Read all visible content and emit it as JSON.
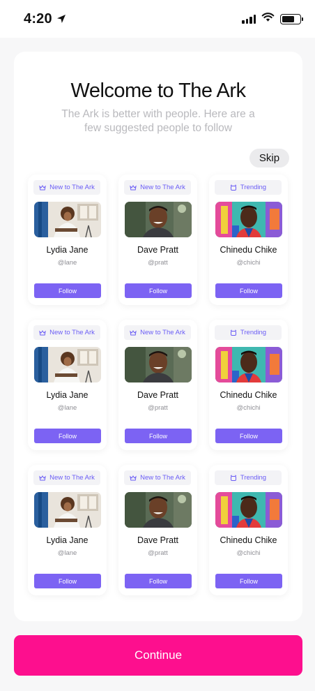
{
  "status_bar": {
    "time": "4:20"
  },
  "header": {
    "title": "Welcome to The Ark",
    "subtitle": "The Ark is better with people. Here are a few suggested people to follow",
    "skip_label": "Skip"
  },
  "cards": [
    {
      "badge": "New to The Ark",
      "badge_icon": "crown-icon",
      "name": "Lydia Jane",
      "handle": "@lane",
      "button": "Follow",
      "photo": "lydia"
    },
    {
      "badge": "New to The Ark",
      "badge_icon": "crown-icon",
      "name": "Dave Pratt",
      "handle": "@pratt",
      "button": "Follow",
      "photo": "dave"
    },
    {
      "badge": "Trending",
      "badge_icon": "alarm-icon",
      "name": "Chinedu Chike",
      "handle": "@chichi",
      "button": "Follow",
      "photo": "chinedu"
    },
    {
      "badge": "New to The Ark",
      "badge_icon": "crown-icon",
      "name": "Lydia Jane",
      "handle": "@lane",
      "button": "Follow",
      "photo": "lydia"
    },
    {
      "badge": "New to The Ark",
      "badge_icon": "crown-icon",
      "name": "Dave Pratt",
      "handle": "@pratt",
      "button": "Follow",
      "photo": "dave"
    },
    {
      "badge": "Trending",
      "badge_icon": "alarm-icon",
      "name": "Chinedu Chike",
      "handle": "@chichi",
      "button": "Follow",
      "photo": "chinedu"
    },
    {
      "badge": "New to The Ark",
      "badge_icon": "crown-icon",
      "name": "Lydia Jane",
      "handle": "@lane",
      "button": "Follow",
      "photo": "lydia"
    },
    {
      "badge": "New to The Ark",
      "badge_icon": "crown-icon",
      "name": "Dave Pratt",
      "handle": "@pratt",
      "button": "Follow",
      "photo": "dave"
    },
    {
      "badge": "Trending",
      "badge_icon": "alarm-icon",
      "name": "Chinedu Chike",
      "handle": "@chichi",
      "button": "Follow",
      "photo": "chinedu"
    }
  ],
  "footer": {
    "continue_label": "Continue"
  },
  "colors": {
    "accent": "#7c63f3",
    "badge_text": "#6a5cf5",
    "continue": "#fd0f8e",
    "subtitle": "#b9b9bd"
  }
}
